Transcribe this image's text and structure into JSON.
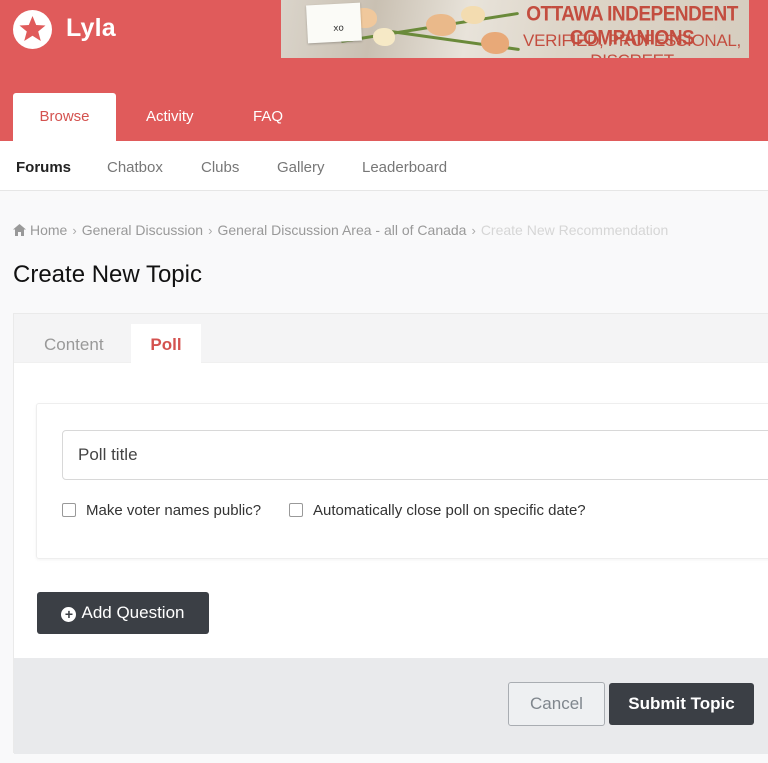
{
  "site": {
    "name": "Lyla",
    "logo_icon": "star-in-circle-icon",
    "brand_color": "#e05b5b"
  },
  "banner": {
    "line1": "OTTAWA INDEPENDENT COMPANIONS",
    "line2": "VERIFIED, PROFESSIONAL, DISCREET",
    "card_text": "xo"
  },
  "main_nav": {
    "items": [
      {
        "label": "Browse",
        "active": true
      },
      {
        "label": "Activity",
        "active": false
      },
      {
        "label": "FAQ",
        "active": false
      }
    ]
  },
  "sub_nav": {
    "items": [
      {
        "label": "Forums",
        "active": true
      },
      {
        "label": "Chatbox",
        "active": false
      },
      {
        "label": "Clubs",
        "active": false
      },
      {
        "label": "Gallery",
        "active": false
      },
      {
        "label": "Leaderboard",
        "active": false
      }
    ]
  },
  "breadcrumb": {
    "home_icon": "home-icon",
    "items": [
      "Home",
      "General Discussion",
      "General Discussion Area - all of Canada",
      "Create New Recommendation"
    ]
  },
  "page": {
    "title": "Create New Topic"
  },
  "form": {
    "tabs": [
      {
        "label": "Content",
        "active": false
      },
      {
        "label": "Poll",
        "active": true
      }
    ],
    "poll": {
      "title_placeholder": "Poll title",
      "title_value": "",
      "voter_public_label": "Make voter names public?",
      "voter_public_checked": false,
      "auto_close_label": "Automatically close poll on specific date?",
      "auto_close_checked": false
    },
    "add_question_label": "Add Question",
    "cancel_label": "Cancel",
    "submit_label": "Submit Topic"
  }
}
